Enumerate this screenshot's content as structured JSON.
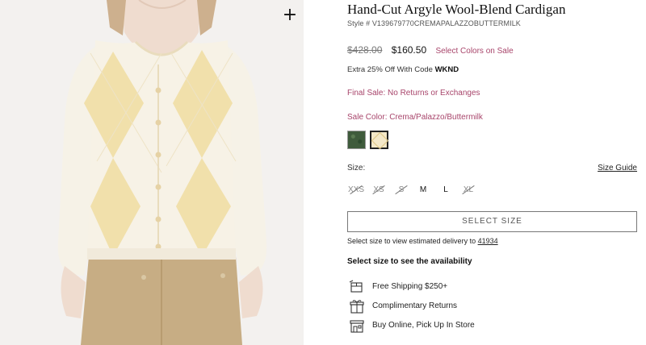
{
  "image": {
    "zoom_icon": "plus-icon",
    "colors": {
      "background": "#f1efed",
      "cardigan": "#f6f1e4",
      "argyle": "#f0dfa9",
      "pants": "#c5aa80",
      "skin": "#efdccf"
    }
  },
  "product": {
    "title": "Hand-Cut Argyle Wool-Blend Cardigan",
    "style_number": "Style # V139679770CREMAPALAZZOBUTTERMILK",
    "price_original": "$428.00",
    "price_sale": "$160.50",
    "sale_link": "Select Colors on Sale",
    "promo_prefix": "Extra 25% Off With Code",
    "promo_code": "WKND",
    "final_sale": "Final Sale: No Returns or Exchanges",
    "sale_color_label": "Sale Color:",
    "sale_color_value": "Crema/Palazzo/Buttermilk",
    "swatches": [
      {
        "name": "green",
        "color": "#3f5b3c"
      },
      {
        "name": "Crema/Palazzo/Buttermilk",
        "color": "#f4e8c8",
        "selected": true
      }
    ]
  },
  "size": {
    "label": "Size:",
    "guide": "Size Guide",
    "options": [
      {
        "label": "XXS",
        "available": false
      },
      {
        "label": "XS",
        "available": false
      },
      {
        "label": "S",
        "available": false
      },
      {
        "label": "M",
        "available": true
      },
      {
        "label": "L",
        "available": true
      },
      {
        "label": "XL",
        "available": false
      }
    ],
    "select_button": "SELECT SIZE"
  },
  "delivery": {
    "text": "Select size to view estimated delivery to",
    "zip": "41934",
    "availability": "Select size to see the availability"
  },
  "features": [
    {
      "icon": "shipping-box-icon",
      "label": "Free Shipping $250+"
    },
    {
      "icon": "gift-box-icon",
      "label": "Complimentary Returns"
    },
    {
      "icon": "store-icon",
      "label": "Buy Online, Pick Up In Store"
    }
  ],
  "colors": {
    "accent": "#a8456b",
    "text": "#222222",
    "muted": "#777777"
  }
}
